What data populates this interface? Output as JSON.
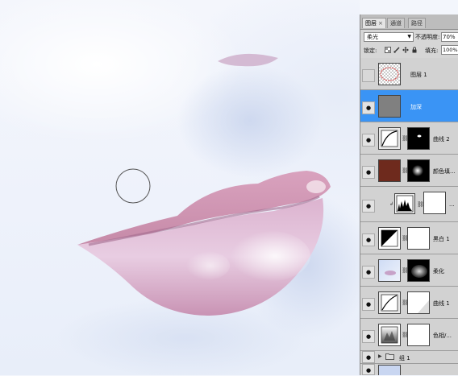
{
  "canvas": {
    "cursor": "brush-circle"
  },
  "panel": {
    "tabs": [
      {
        "label": "图层",
        "close": "×",
        "active": true
      },
      {
        "label": "通道",
        "active": false
      },
      {
        "label": "路径",
        "active": false
      }
    ],
    "blend_mode": "柔光",
    "opacity_label": "不透明度:",
    "opacity_value": "70%",
    "lock_label": "锁定:",
    "lock_icons": [
      "transparency-lock-icon",
      "brush-lock-icon",
      "move-lock-icon",
      "padlock-icon"
    ],
    "fill_label": "填充:",
    "fill_value": "100%",
    "layers": [
      {
        "name": "图层 1",
        "kind": "pixel-empty",
        "visible": false,
        "selected": false
      },
      {
        "name": "加深",
        "kind": "gray",
        "visible": true,
        "selected": true
      },
      {
        "name": "曲线 2",
        "kind": "curves",
        "visible": true,
        "selected": false
      },
      {
        "name": "颜色填...",
        "kind": "color-fill",
        "visible": true,
        "selected": false,
        "color": "#6e2a1d"
      },
      {
        "name": "...",
        "kind": "levels",
        "visible": true,
        "selected": false
      },
      {
        "name": "黑白 1",
        "kind": "black-white",
        "visible": true,
        "selected": false
      },
      {
        "name": "柔化",
        "kind": "photo",
        "visible": true,
        "selected": false
      },
      {
        "name": "曲线 1",
        "kind": "curves",
        "visible": true,
        "selected": false
      },
      {
        "name": "色相/...",
        "kind": "hue-sat",
        "visible": true,
        "selected": false
      },
      {
        "name": "组 1",
        "kind": "group",
        "visible": true,
        "selected": false
      }
    ]
  }
}
